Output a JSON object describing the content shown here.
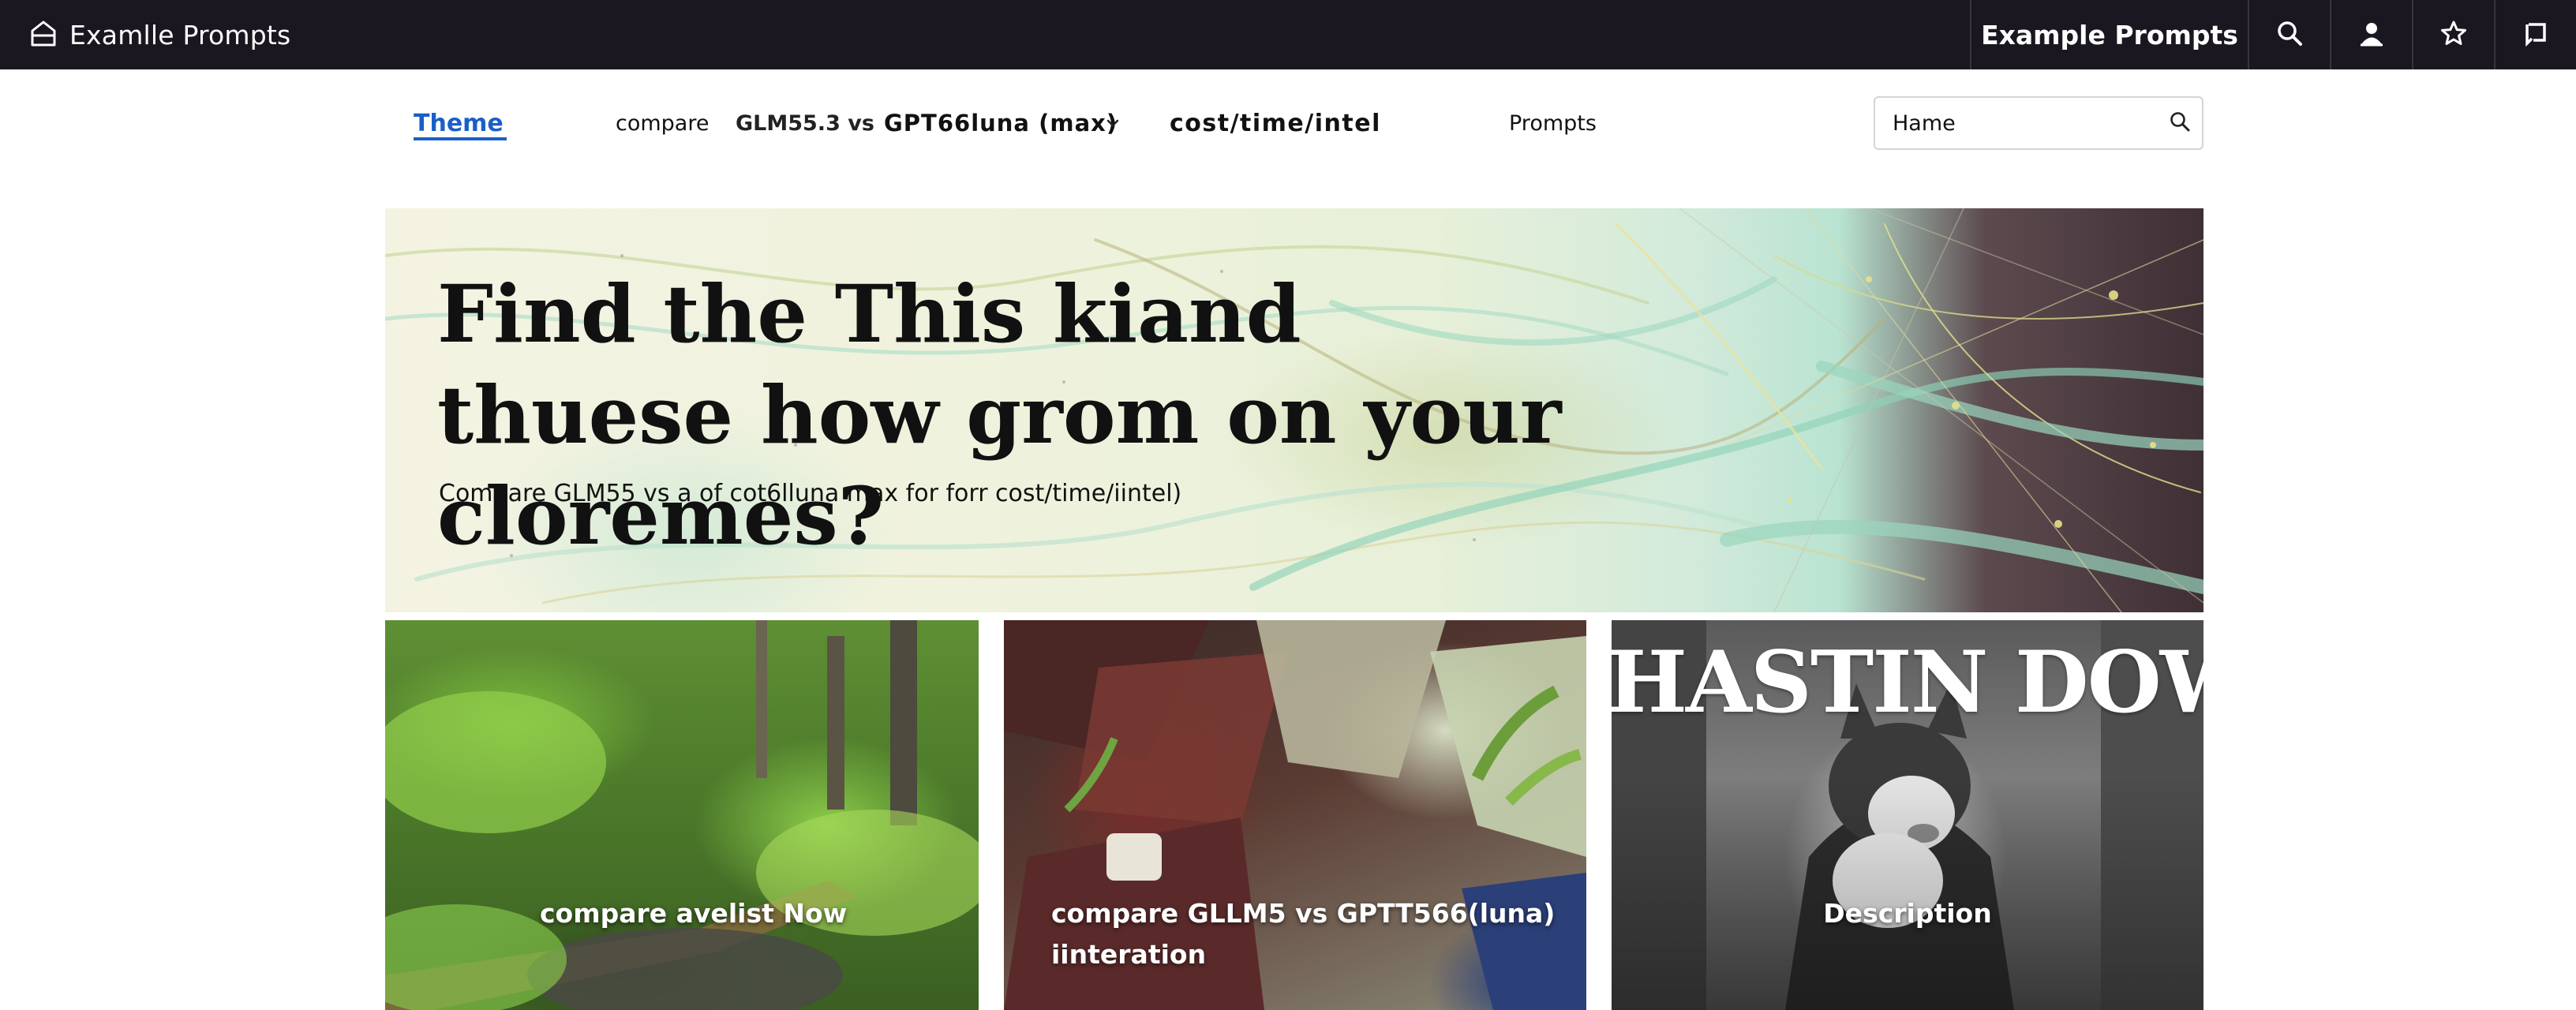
{
  "topbar": {
    "brand_title": "Examlle Prompts",
    "right_title": "Example Prompts",
    "icons": [
      "search-icon",
      "user-icon",
      "star-icon",
      "share-icon"
    ]
  },
  "nav": {
    "theme": "Theme",
    "compare": "compare",
    "glm": "GLM55.3 vs",
    "gpt": "GPT66luna (max)",
    "cost": "cost/time/intel",
    "prompts": "Prompts"
  },
  "search": {
    "value": "Hame"
  },
  "hero": {
    "title": "Find the This kiand thuese how grom on your cloremes?",
    "subtitle": "Compare GLM55 vs a of cot6lluna max for forr cost/time/iintel)"
  },
  "cards": [
    {
      "caption": "compare avelist Now"
    },
    {
      "caption": "compare GLLM5 vs GPTT566(luna) iinteration"
    },
    {
      "caption": "Description",
      "banner": "HASTIN DOW"
    }
  ],
  "colors": {
    "topbar_bg": "#1b1720",
    "accent": "#1a5fc7"
  }
}
